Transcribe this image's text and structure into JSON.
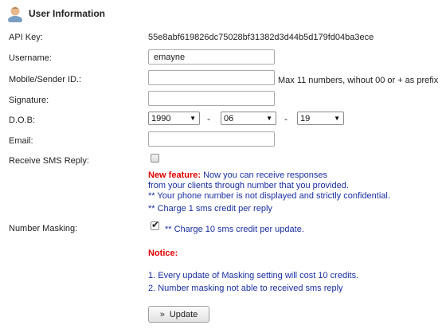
{
  "header": {
    "title": "User Information",
    "icon": "user-icon"
  },
  "api_key": {
    "label": "API Key:",
    "value": "55e8abf619826dc75028bf31382d3d44b5d179fd04ba3ece"
  },
  "username": {
    "label": "Username:",
    "value": "emayne"
  },
  "sender": {
    "label": "Mobile/Sender ID.:",
    "value": "",
    "hint": "Max 11 numbers, wihout 00 or + as prefix"
  },
  "signature": {
    "label": "Signature:",
    "value": ""
  },
  "dob": {
    "label": "D.O.B:",
    "year": "1990",
    "month": "06",
    "day": "19",
    "separator": "-"
  },
  "email": {
    "label": "Email:",
    "value": ""
  },
  "sms_reply": {
    "label": "Receive SMS Reply:",
    "checked": false,
    "new_feature_label": "New feature:",
    "line1": " Now you can receive responses",
    "line2": "from your clients through number that you provided.",
    "line3": "** Your phone number is not displayed and strictly confidential.",
    "line4": "** Charge 1 sms credit per reply"
  },
  "masking": {
    "label": "Number Masking:",
    "checked": true,
    "charge_note": "** Charge 10 sms credit per update.",
    "notice_title": "Notice:",
    "notice_1": "1. Every update of Masking setting will cost 10 credits.",
    "notice_2": "2. Number masking not able to received sms reply"
  },
  "update_button": {
    "label": "Update",
    "icon": "chevron-double-right-icon"
  },
  "colors": {
    "blue_text": "#1a2ea0",
    "red_text": "#e00000"
  }
}
